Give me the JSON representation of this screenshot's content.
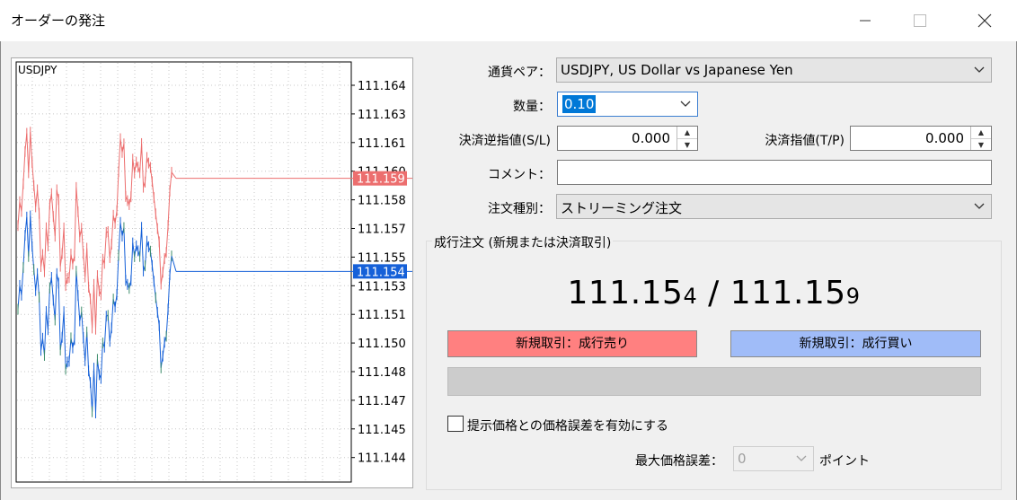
{
  "window": {
    "title": "オーダーの発注",
    "minimize_icon": "minimize-icon",
    "maximize_icon": "maximize-icon",
    "close_icon": "close-icon"
  },
  "chart": {
    "symbol": "USDJPY",
    "price_labels": [
      "111.164",
      "111.163",
      "111.161",
      "111.160",
      "111.158",
      "111.157",
      "111.155",
      "111.153",
      "111.151",
      "111.150",
      "111.148",
      "111.147",
      "111.145",
      "111.144"
    ],
    "bid_label": "111.154",
    "ask_label": "111.159",
    "bid_color": "#1560d8",
    "ask_color": "#ec6e6e",
    "bull_bar_color": "#3c8c6a"
  },
  "form": {
    "currency_pair_label": "通貨ペア：",
    "currency_pair_value": "USDJPY, US Dollar vs Japanese Yen",
    "volume_label": "数量：",
    "volume_value": "0.10",
    "sl_label": "決済逆指値(S/L)",
    "sl_value": "0.000",
    "tp_label": "決済指値(T/P)",
    "tp_value": "0.000",
    "comment_label": "コメント：",
    "comment_value": "",
    "order_type_label": "注文種別：",
    "order_type_value": "ストリーミング注文"
  },
  "market": {
    "group_title": "成行注文 (新規または決済取引)",
    "bid_main": "111.15",
    "bid_small": "4",
    "separator": " / ",
    "ask_main": "111.15",
    "ask_small": "9",
    "sell_button": "新規取引：成行売り",
    "buy_button": "新規取引：成行買い",
    "sell_color": "#ff8080",
    "buy_color": "#a0bcf8",
    "deviation_checkbox_label": "提示価格との価格誤差を有効にする",
    "max_deviation_label": "最大価格誤差：",
    "max_deviation_value": "0",
    "points_label": "ポイント"
  }
}
